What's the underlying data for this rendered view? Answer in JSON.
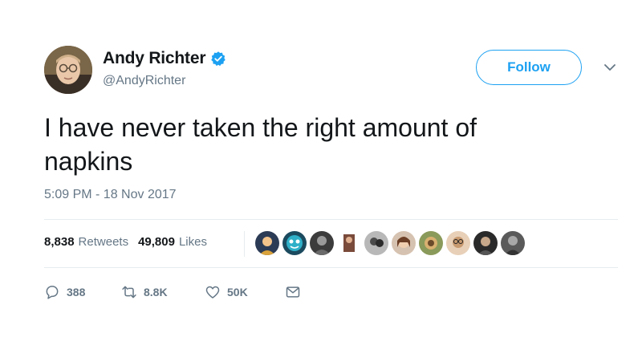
{
  "author": {
    "display_name": "Andy Richter",
    "handle": "@AndyRichter",
    "verified": true
  },
  "follow_label": "Follow",
  "tweet_text": "I have never taken the right amount of napkins",
  "timestamp": "5:09 PM - 18 Nov 2017",
  "stats": {
    "retweets_count": "8,838",
    "retweets_label": "Retweets",
    "likes_count": "49,809",
    "likes_label": "Likes"
  },
  "actions": {
    "reply_count": "388",
    "retweet_count": "8.8K",
    "like_count": "50K"
  },
  "colors": {
    "accent": "#1da1f2",
    "muted": "#657786",
    "text": "#14171a",
    "divider": "#e6ecf0"
  },
  "icons": [
    "verified-badge-icon",
    "chevron-down-icon",
    "reply-icon",
    "retweet-icon",
    "heart-icon",
    "message-icon"
  ]
}
